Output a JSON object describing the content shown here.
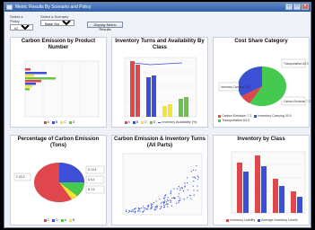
{
  "window": {
    "title": "Metric Results By Scenario and Policy"
  },
  "controls": {
    "policy_label": "Select a Policy",
    "policy_value": "(Q,r)",
    "scenario_label": "Select a Scenario",
    "scenario_value": "Base Scenario",
    "display_button": "Display Metric Results"
  },
  "panels": {
    "carbon_by_product": {
      "title": "Carbon Emission by Product Number",
      "legend": [
        "A",
        "B",
        "C",
        "D"
      ],
      "colors": [
        "#e0474c",
        "#3d4fd6",
        "#f2e432",
        "#6cc24a"
      ]
    },
    "inventory_turns": {
      "title": "Inventory Turns and Availability By Class",
      "legend": [
        "A",
        "B",
        "C",
        "D",
        "Inventory Availability (%)"
      ],
      "colors": [
        "#e0474c",
        "#3d4fd6",
        "#f2e432",
        "#6cc24a",
        "#3d4fd6"
      ]
    },
    "cost_share": {
      "title": "Cost Share Category",
      "legend": [
        "Carbon Emission 7.2",
        "Inventory Carrying 30.0",
        "Transportation 63.9"
      ],
      "colors": [
        "#e0474c",
        "#3d4fd6",
        "#45c94f"
      ],
      "labels": [
        "Transportation 63.9",
        "Inventory Carrying 30.0",
        "Carbon Emission 7.2"
      ]
    },
    "pct_carbon": {
      "title": "Percentage of Carbon Emission (Tons)",
      "legend": [
        "C",
        "D",
        "A",
        "B"
      ],
      "colors": [
        "#e0474c",
        "#3d4fd6",
        "#45c94f",
        "#f2e432"
      ],
      "labels": [
        "C 63.3",
        "D 24.4",
        "A 6.4",
        "B 2.5"
      ]
    },
    "carbon_vs_turns": {
      "title": "Carbon Emission & Inventory Turns (All Parts)"
    },
    "inventory_by_class": {
      "title": "Inventory by Class",
      "legend": [
        "Inventory Liability",
        "Average Inventory Levels"
      ],
      "colors": [
        "#e0474c",
        "#3d4fd6"
      ]
    }
  }
}
